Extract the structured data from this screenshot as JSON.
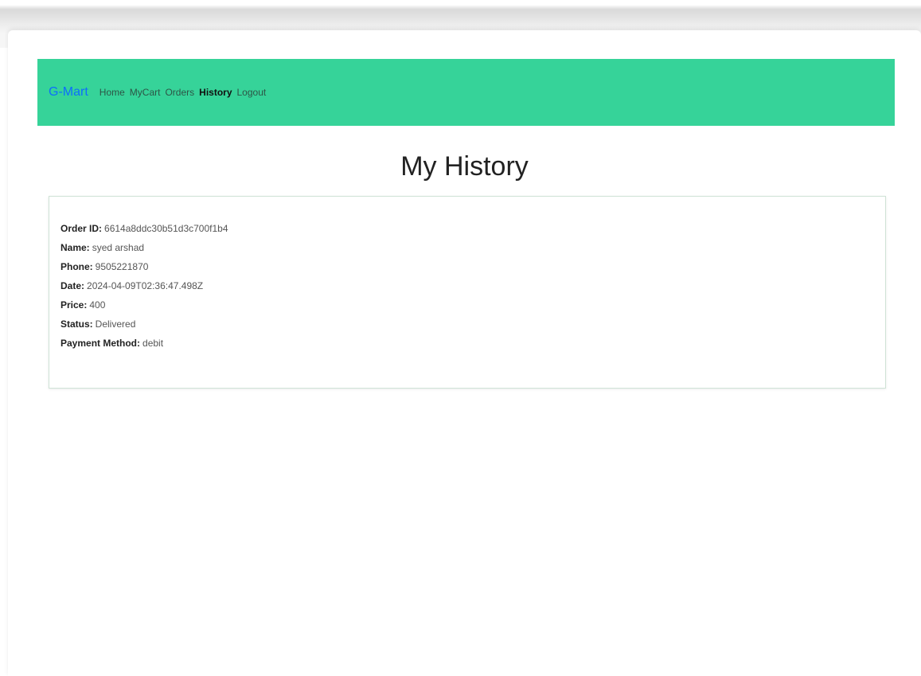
{
  "nav": {
    "brand": "G-Mart",
    "links": [
      {
        "label": "Home"
      },
      {
        "label": "MyCart"
      },
      {
        "label": "Orders"
      },
      {
        "label": "History",
        "active": true
      },
      {
        "label": "Logout"
      }
    ]
  },
  "page": {
    "title": "My History"
  },
  "order": {
    "fields": [
      {
        "label": "Order ID:",
        "value": "6614a8ddc30b51d3c700f1b4"
      },
      {
        "label": "Name:",
        "value": "syed arshad"
      },
      {
        "label": "Phone:",
        "value": "9505221870"
      },
      {
        "label": "Date:",
        "value": "2024-04-09T02:36:47.498Z"
      },
      {
        "label": "Price:",
        "value": "400"
      },
      {
        "label": "Status:",
        "value": "Delivered"
      },
      {
        "label": "Payment Method:",
        "value": "debit"
      }
    ]
  },
  "colors": {
    "navbar_bg": "#36d399",
    "brand": "#0d6efd"
  }
}
